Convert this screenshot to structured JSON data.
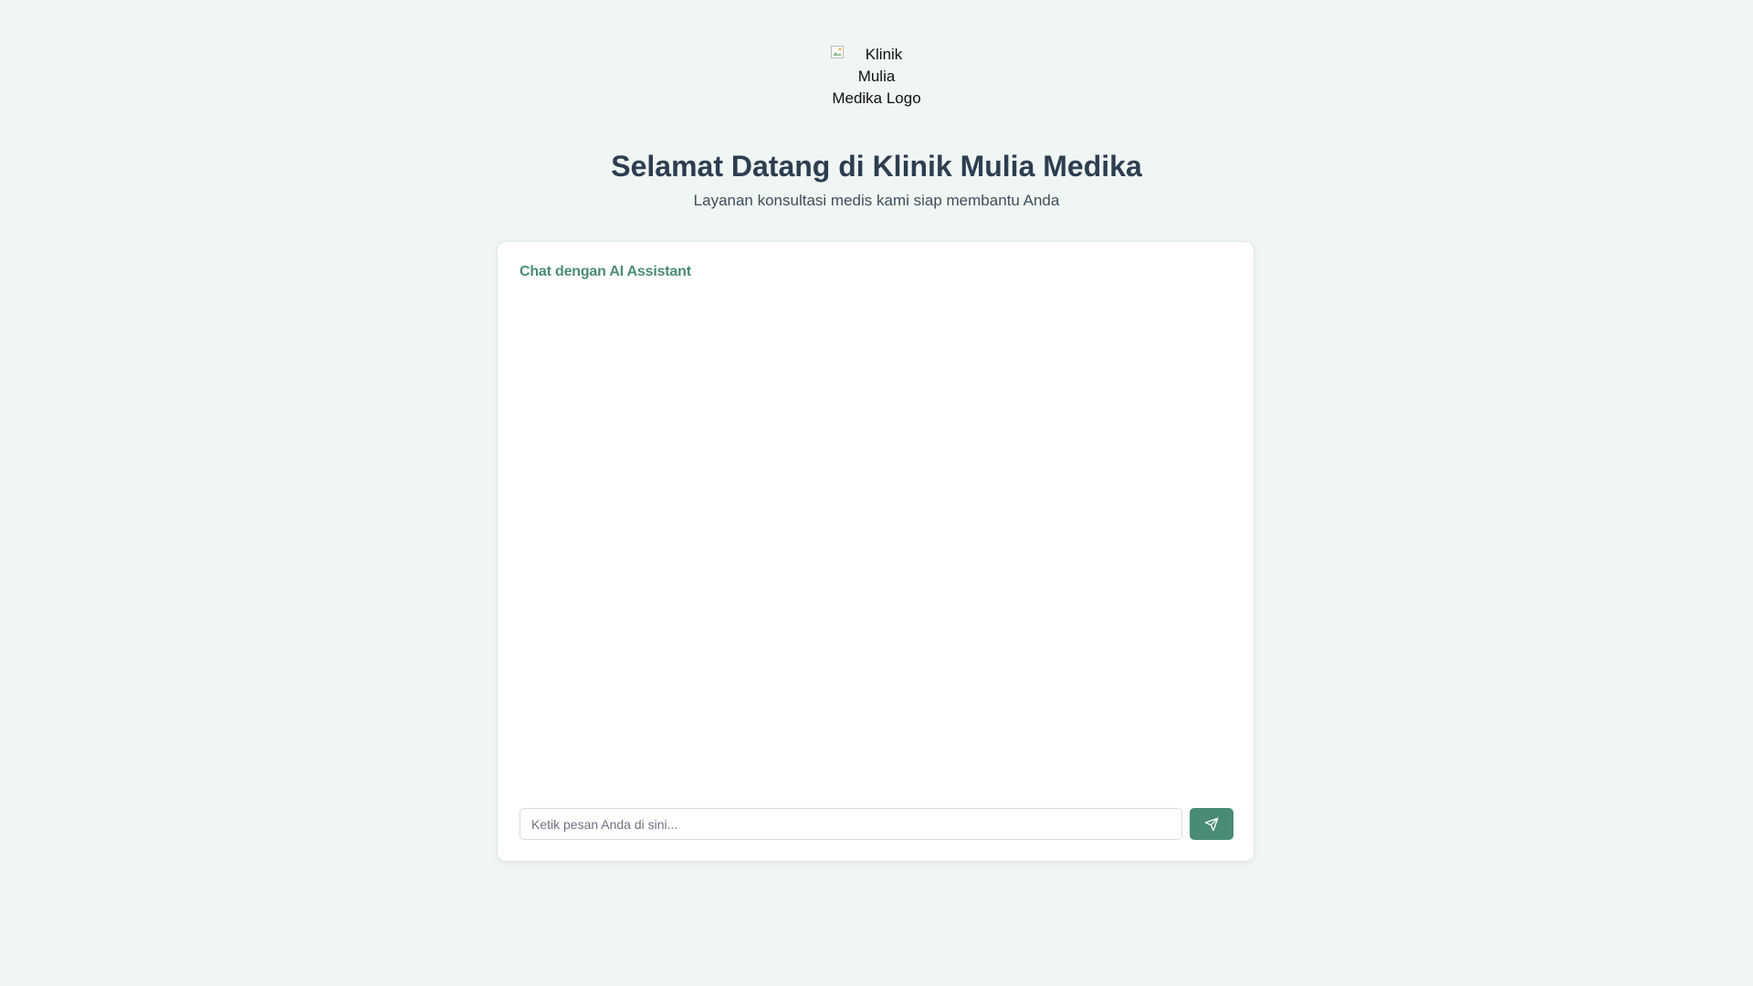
{
  "logo": {
    "alt_text": "Klinik Mulia Medika Logo",
    "icon": "broken-image-icon"
  },
  "header": {
    "title": "Selamat Datang di Klinik Mulia Medika",
    "subtitle": "Layanan konsultasi medis kami siap membantu Anda"
  },
  "chat": {
    "title": "Chat dengan AI Assistant",
    "input_placeholder": "Ketik pesan Anda di sini...",
    "input_value": "",
    "send_icon": "send-icon"
  },
  "colors": {
    "background": "#f0f6f3",
    "accent": "#4a8c73",
    "title_text": "#2c3e50",
    "card": "#ffffff"
  }
}
